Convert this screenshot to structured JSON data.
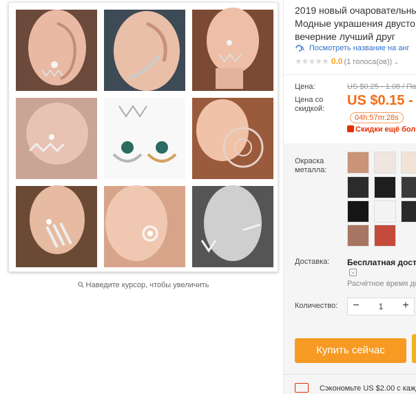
{
  "gallery": {
    "zoom_hint": "Наведите курсор, чтобы увеличить",
    "icon": "magnifier-icon"
  },
  "product": {
    "title_lines": [
      "2019 новый очаровательны",
      "Модные украшения двусто",
      "вечерние лучший друг"
    ],
    "translate_link": "Посмотреть название на анг",
    "rating": {
      "stars": "★★★★★",
      "score": "0.0",
      "votes": "(1 голоса(ов))"
    }
  },
  "price": {
    "label": "Цена:",
    "original": "US $0.25 - 1.08 / Пар",
    "discount_label": "Цена со скидкой:",
    "current": "US $0.15 - (",
    "timer": "04h:57m:28s",
    "discount_note": "Скидки ещё бол"
  },
  "options": {
    "color_label": "Окраска металла:",
    "shipping_label": "Доставка:",
    "shipping_value": "Бесплатная достав",
    "shipping_sub": "Расчётное время до",
    "quantity_label": "Количество:",
    "quantity": "1",
    "minus": "−",
    "plus": "+"
  },
  "actions": {
    "buy_now": "Купить сейчас",
    "coupon": "Сэкономьте US $2.00 с кажд"
  },
  "colors": {
    "accent": "#f36c16",
    "buy": "#f79a24",
    "link": "#2e6fd0",
    "sale": "#e62e04"
  }
}
